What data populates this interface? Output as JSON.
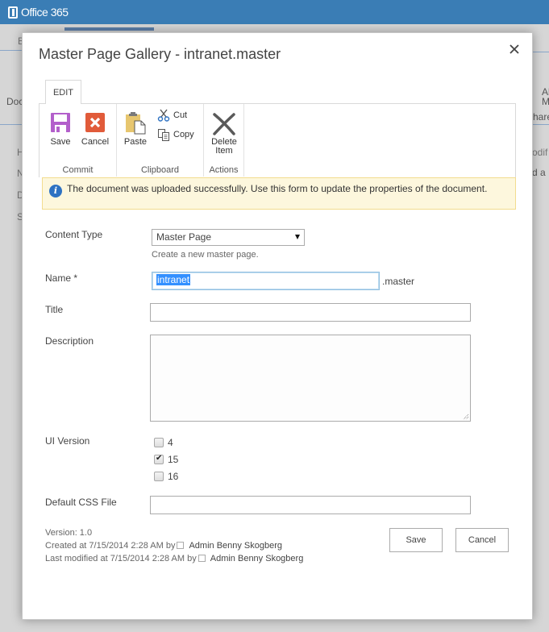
{
  "suite_bar": {
    "brand": "Office 365"
  },
  "background_page": {
    "left_fragments": [
      "B",
      "Doc",
      "H",
      "N",
      "D",
      "S"
    ],
    "right_fragments": [
      "Al",
      "M",
      "hare",
      "odif",
      "d a"
    ]
  },
  "dialog": {
    "title": "Master Page Gallery - intranet.master",
    "close_label": "Close"
  },
  "ribbon": {
    "tab": "EDIT",
    "groups": [
      {
        "label": "Commit",
        "buttons": [
          {
            "label": "Save",
            "icon": "save-icon"
          },
          {
            "label": "Cancel",
            "icon": "cancel-icon"
          }
        ]
      },
      {
        "label": "Clipboard",
        "buttons": [
          {
            "label": "Paste",
            "icon": "paste-icon"
          },
          {
            "label": "Cut",
            "icon": "cut-icon"
          },
          {
            "label": "Copy",
            "icon": "copy-icon"
          }
        ]
      },
      {
        "label": "Actions",
        "buttons": [
          {
            "label_line1": "Delete",
            "label_line2": "Item",
            "icon": "delete-icon"
          }
        ]
      }
    ]
  },
  "message": {
    "icon": "info-icon",
    "text": "The document was uploaded successfully. Use this form to update the properties of the document."
  },
  "form": {
    "content_type": {
      "label": "Content Type",
      "selected": "Master Page",
      "hint": "Create a new master page."
    },
    "name": {
      "label": "Name *",
      "value": "intranet",
      "suffix": ".master"
    },
    "title": {
      "label": "Title",
      "value": ""
    },
    "description": {
      "label": "Description",
      "value": ""
    },
    "ui_version": {
      "label": "UI Version",
      "options": [
        {
          "label": "4",
          "checked": false
        },
        {
          "label": "15",
          "checked": true
        },
        {
          "label": "16",
          "checked": false
        }
      ]
    },
    "default_css": {
      "label": "Default CSS File",
      "value": ""
    }
  },
  "meta": {
    "version": "Version: 1.0",
    "created_prefix": "Created at 7/15/2014 2:28 AM  by",
    "created_by": "Admin Benny Skogberg",
    "modified_prefix": "Last modified at 7/15/2014 2:28 AM  by",
    "modified_by": "Admin Benny Skogberg"
  },
  "buttons": {
    "save": "Save",
    "cancel": "Cancel"
  },
  "colors": {
    "suite_bar": "#3a7db5",
    "message_bg": "#fdf7dd",
    "save_icon": "#b35fcb",
    "cancel_icon": "#e15b3a",
    "info": "#2e72c2"
  }
}
